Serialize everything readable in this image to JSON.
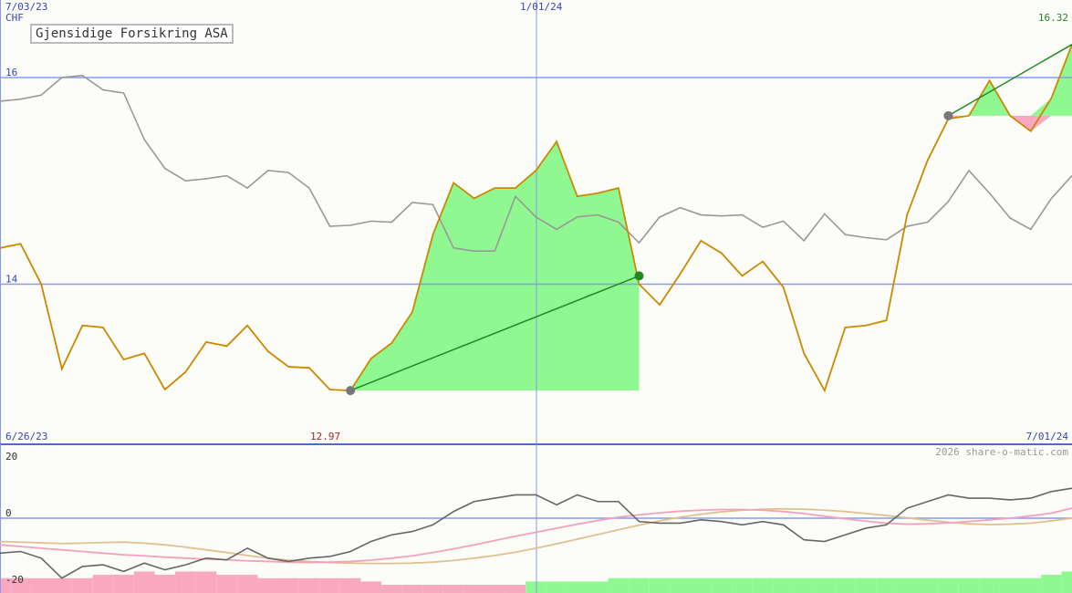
{
  "title": "Gjensidige Forsikring ASA",
  "currency": "CHF",
  "watermark": "2026 share-o-matic.com",
  "labels": {
    "top_start_date": "7/03/23",
    "mid_date": "1/01/24",
    "last_price": "16.32",
    "bottom_start_date": "6/26/23",
    "low_price": "12.97",
    "end_date": "7/01/24"
  },
  "colors": {
    "background": "#fcfdf8",
    "price": "#cc8800",
    "compare": "#999999",
    "gain_fill": "#90f890",
    "loss_fill": "#f8a8c0",
    "trend": "#228822",
    "grid": "#8899ee",
    "macd": "#666666",
    "pink_ma": "#f4a0c0",
    "tan_ma": "#e0c090"
  },
  "chart_data": [
    {
      "type": "line",
      "title": "Gjensidige Forsikring ASA",
      "ylabel": "CHF",
      "ylim": [
        12.45,
        16.75
      ],
      "yticks": [
        {
          "value": 14,
          "label": "14"
        },
        {
          "value": 16,
          "label": "16"
        }
      ],
      "x_range": [
        0,
        52
      ],
      "grid": true,
      "series": [
        {
          "role": "price",
          "values": [
            14.35,
            14.39,
            14.0,
            13.18,
            13.6,
            13.58,
            13.27,
            13.33,
            12.98,
            13.15,
            13.44,
            13.4,
            13.6,
            13.35,
            13.2,
            13.19,
            12.98,
            12.97,
            13.28,
            13.43,
            13.73,
            14.48,
            14.98,
            14.83,
            14.93,
            14.93,
            15.1,
            15.38,
            14.85,
            14.88,
            14.93,
            14.0,
            13.8,
            14.1,
            14.42,
            14.3,
            14.08,
            14.22,
            13.97,
            13.33,
            12.97,
            13.58,
            13.6,
            13.65,
            14.67,
            15.2,
            15.6,
            15.63,
            15.97,
            15.63,
            15.48,
            15.8,
            16.32
          ]
        },
        {
          "role": "comparison",
          "values": [
            15.77,
            15.79,
            15.83,
            16.0,
            16.02,
            15.88,
            15.85,
            15.4,
            15.12,
            15.0,
            15.02,
            15.05,
            14.93,
            15.1,
            15.08,
            14.93,
            14.56,
            14.57,
            14.61,
            14.6,
            14.79,
            14.77,
            14.35,
            14.32,
            14.32,
            14.85,
            14.65,
            14.53,
            14.65,
            14.67,
            14.6,
            14.4,
            14.65,
            14.74,
            14.67,
            14.66,
            14.67,
            14.55,
            14.61,
            14.42,
            14.68,
            14.48,
            14.45,
            14.43,
            14.56,
            14.6,
            14.8,
            15.1,
            14.88,
            14.64,
            14.53,
            14.83,
            15.05
          ]
        }
      ],
      "trend_segments": [
        {
          "from": [
            17,
            12.97
          ],
          "to": [
            31,
            14.08
          ]
        },
        {
          "from": [
            46,
            15.63
          ],
          "to": [
            52,
            16.32
          ]
        }
      ]
    },
    {
      "type": "line",
      "title": "",
      "ylim": [
        -20,
        20
      ],
      "yticks": [
        {
          "value": 20,
          "label": "20"
        },
        {
          "value": 0,
          "label": "0"
        },
        {
          "value": -20,
          "label": "-20"
        }
      ],
      "x_range": [
        0,
        52
      ],
      "series": [
        {
          "role": "macd",
          "values": [
            -10.5,
            -10,
            -12,
            -18,
            -14.5,
            -14,
            -16,
            -13.5,
            -15.5,
            -14,
            -12,
            -12.5,
            -9,
            -12,
            -13,
            -12,
            -11.5,
            -10,
            -7,
            -5,
            -4,
            -2,
            2,
            5,
            6,
            7,
            7,
            4,
            7,
            5,
            5,
            -1,
            -1.5,
            -1.5,
            -0.5,
            -1,
            -2,
            -1,
            -2,
            -6.5,
            -7,
            -5,
            -3,
            -2,
            3,
            5,
            7,
            6,
            6,
            5.5,
            6,
            8,
            9
          ]
        },
        {
          "role": "pink_average",
          "values": [
            -8,
            -8.5,
            -9,
            -9.5,
            -10,
            -10.5,
            -11,
            -11.3,
            -11.7,
            -12,
            -12.3,
            -12.5,
            -12.8,
            -13,
            -13.2,
            -13.3,
            -13.2,
            -13,
            -12.6,
            -12,
            -11.3,
            -10.3,
            -9.2,
            -8,
            -6.7,
            -5.4,
            -4.2,
            -3,
            -1.8,
            -0.7,
            0.3,
            1,
            1.6,
            2.1,
            2.4,
            2.6,
            2.6,
            2.4,
            2,
            1.4,
            0.6,
            -0.2,
            -0.9,
            -1.5,
            -1.8,
            -1.7,
            -1.4,
            -1,
            -0.5,
            0,
            0.7,
            1.5,
            3
          ]
        },
        {
          "role": "tan_average",
          "values": [
            -7,
            -7.2,
            -7.4,
            -7.6,
            -7.5,
            -7.3,
            -7.2,
            -7.5,
            -8,
            -8.7,
            -9.5,
            -10.3,
            -11.2,
            -12,
            -12.6,
            -13,
            -13.3,
            -13.5,
            -13.6,
            -13.6,
            -13.5,
            -13.2,
            -12.7,
            -12,
            -11.2,
            -10.2,
            -9,
            -7.7,
            -6.3,
            -4.9,
            -3.5,
            -2.1,
            -0.8,
            0.3,
            1.2,
            1.9,
            2.4,
            2.7,
            2.8,
            2.7,
            2.4,
            2,
            1.4,
            0.8,
            0.1,
            -0.6,
            -1.2,
            -1.7,
            -1.9,
            -1.8,
            -1.5,
            -0.8,
            0
          ]
        }
      ],
      "histogram": [
        -18,
        -18,
        -18,
        -18,
        -18,
        -17,
        -17,
        -16,
        -17,
        -16,
        -16,
        -17,
        -17,
        -18,
        -18,
        -18,
        -18,
        -18,
        -19,
        -20,
        -20,
        -20,
        -20,
        -20,
        -20,
        -20,
        -19,
        -19,
        -19,
        -19,
        -18,
        -18,
        -18,
        -18,
        -18,
        -18,
        -18,
        -18,
        -18,
        -18,
        -18,
        -18,
        -18,
        -18,
        -18,
        -18,
        -18,
        -18,
        -18,
        -18,
        -18,
        -17,
        -16
      ]
    }
  ]
}
